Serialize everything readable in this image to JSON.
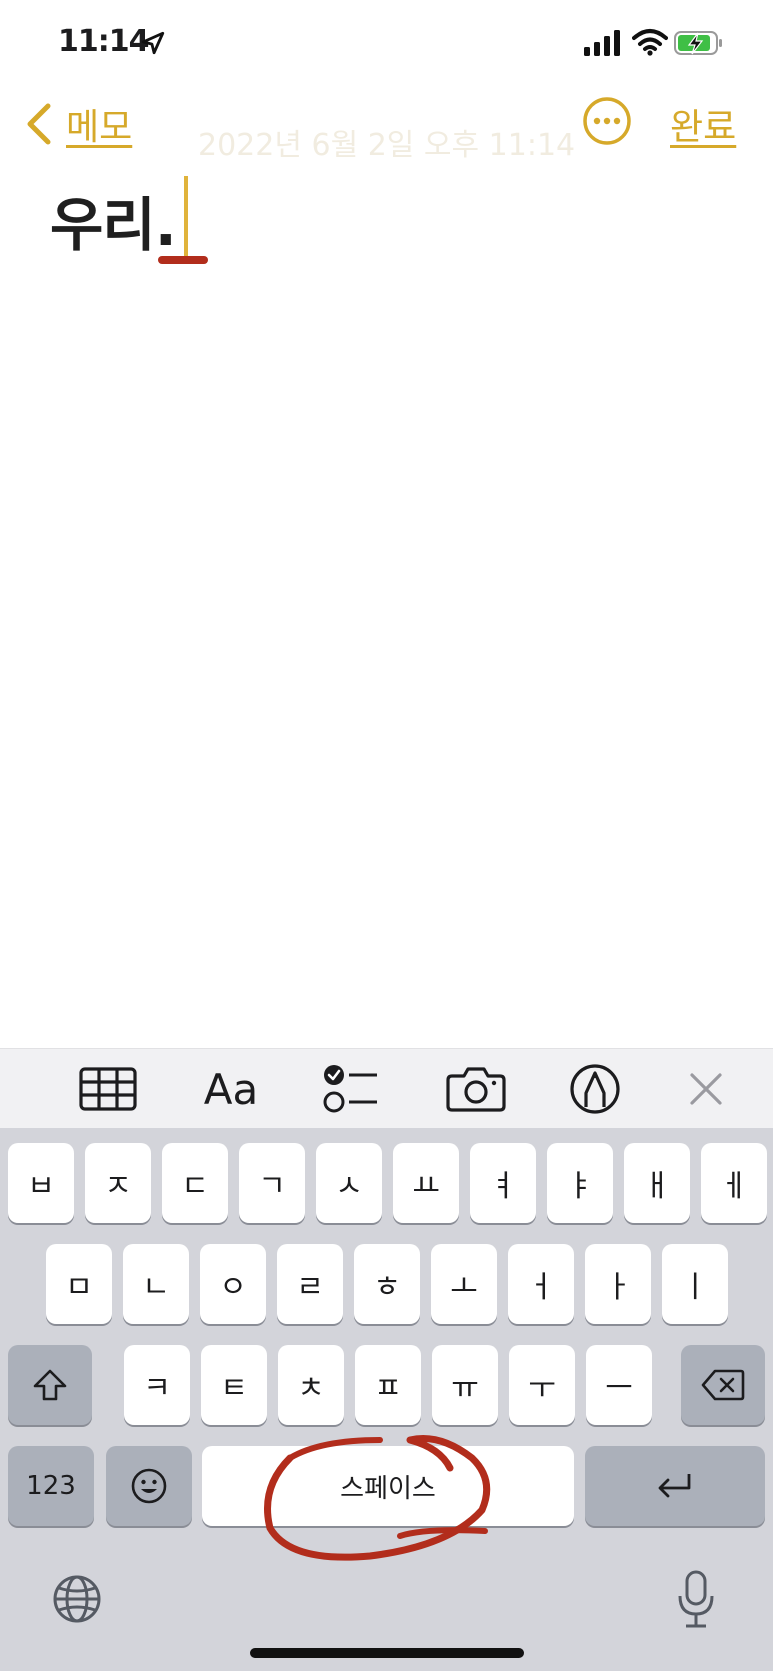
{
  "status_bar": {
    "time": "11:14",
    "battery_color": "#3fbf45"
  },
  "nav": {
    "back_label": "메모",
    "done_label": "완료",
    "date_faint": "2022년 6월 2일 오후 11:14",
    "accent_color": "#d6a92a"
  },
  "note": {
    "text": "우리."
  },
  "toolbar": {
    "items": [
      "table-icon",
      "text-format-icon",
      "checklist-icon",
      "camera-icon",
      "markup-pen-icon",
      "close-icon"
    ],
    "format_label": "Aa"
  },
  "keyboard": {
    "row1": [
      "ㅂ",
      "ㅈ",
      "ㄷ",
      "ㄱ",
      "ㅅ",
      "ㅛ",
      "ㅕ",
      "ㅑ",
      "ㅐ",
      "ㅔ"
    ],
    "row2": [
      "ㅁ",
      "ㄴ",
      "ㅇ",
      "ㄹ",
      "ㅎ",
      "ㅗ",
      "ㅓ",
      "ㅏ",
      "ㅣ"
    ],
    "row3": [
      "ㅋ",
      "ㅌ",
      "ㅊ",
      "ㅍ",
      "ㅠ",
      "ㅜ",
      "ㅡ"
    ],
    "numbers_label": "123",
    "space_label": "스페이스"
  }
}
